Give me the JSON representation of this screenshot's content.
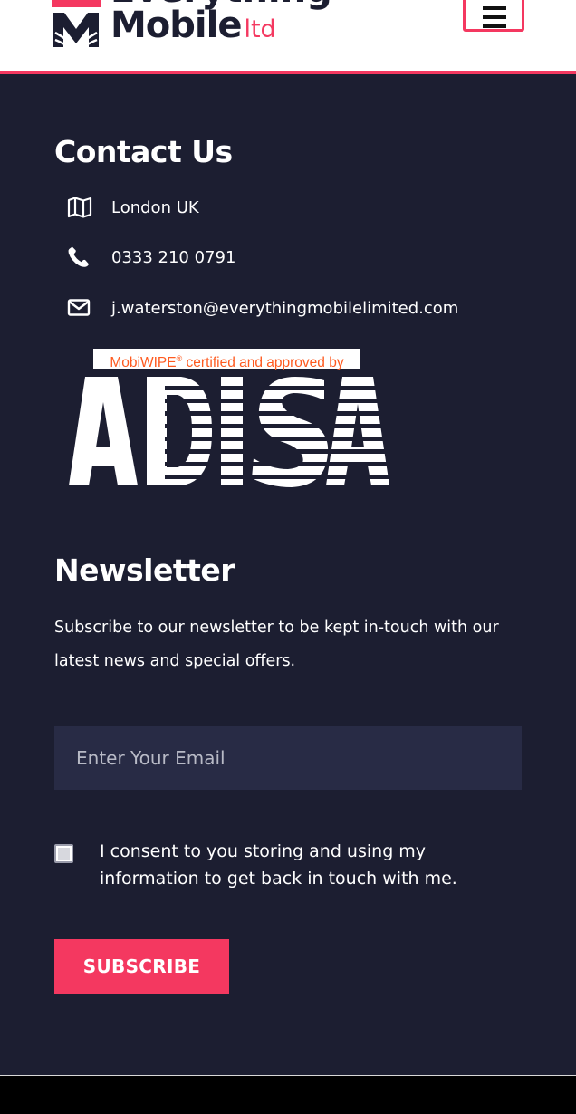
{
  "header": {
    "logo_top_word": "Everything",
    "logo_word": "Mobile",
    "logo_suffix": "ltd",
    "menu_icon": "hamburger-icon"
  },
  "contact": {
    "title": "Contact Us",
    "items": [
      {
        "icon": "map-icon",
        "text": "London UK"
      },
      {
        "icon": "phone-icon",
        "text": "0333 210 0791"
      },
      {
        "icon": "envelope-icon",
        "text": "j.waterston@everythingmobilelimited.com"
      }
    ]
  },
  "badge": {
    "caption_prefix": "MobiWIPE",
    "caption_mark": "®",
    "caption_suffix": " certified and approved by",
    "brand": "ADISA"
  },
  "newsletter": {
    "title": "Newsletter",
    "description": "Subscribe to our newsletter to be kept in-touch with our latest news and special offers.",
    "email_placeholder": "Enter Your Email",
    "email_value": "",
    "consent_label": "I consent to you storing and using my information to get back in touch with me.",
    "subscribe_label": "SUBSCRIBE"
  },
  "colors": {
    "background": "#1c1e31",
    "accent": "#f43860",
    "input_background": "#282b45"
  }
}
